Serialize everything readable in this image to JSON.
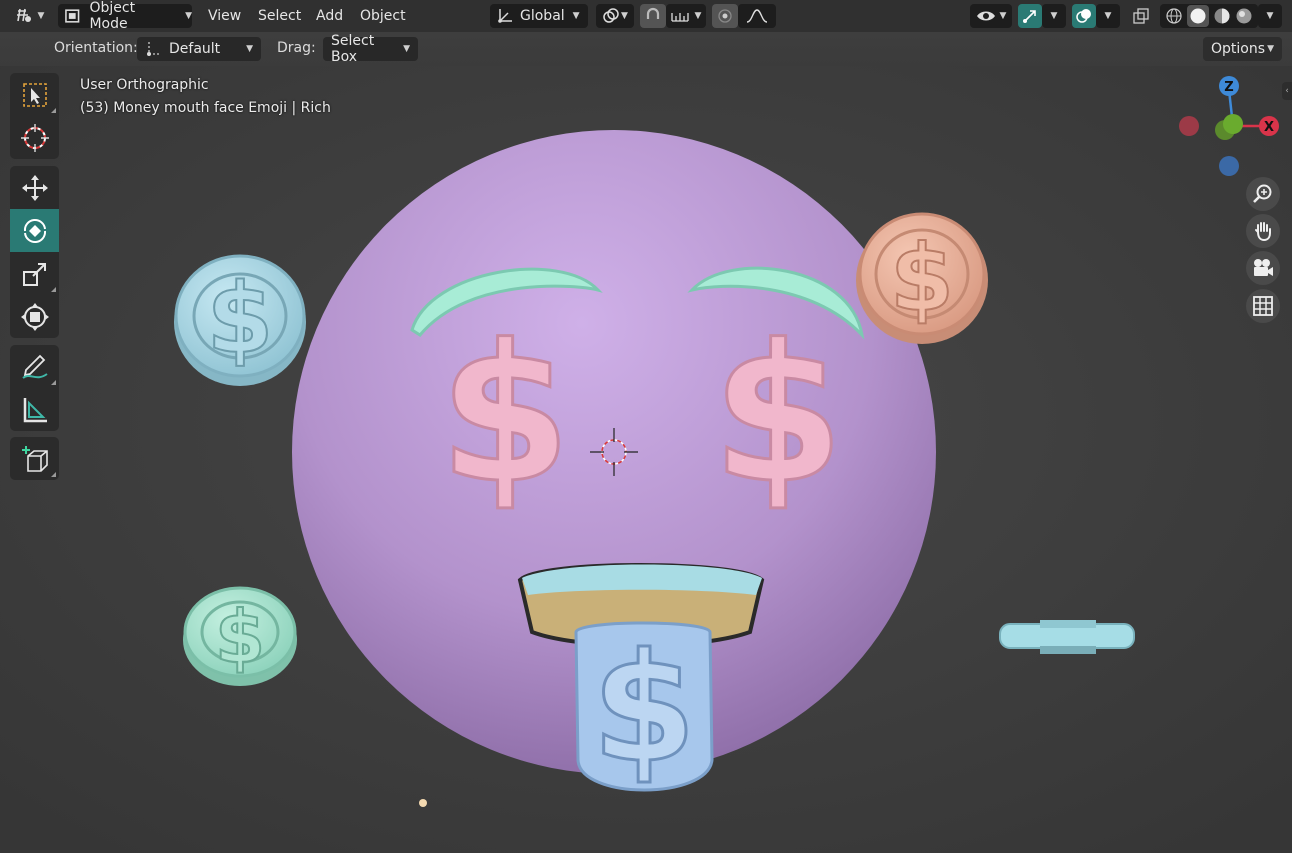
{
  "header": {
    "mode_label": "Object Mode",
    "menus": [
      "View",
      "Select",
      "Add",
      "Object"
    ],
    "transform_orientation": "Global"
  },
  "tool_settings": {
    "orientation_label": "Orientation:",
    "orientation_value": "Default",
    "drag_label": "Drag:",
    "drag_value": "Select Box",
    "options_label": "Options"
  },
  "viewport": {
    "view_name": "User Orthographic",
    "object_info": "(53) Money mouth face Emoji | Rich",
    "gizmo": {
      "z": "Z",
      "x": "X"
    }
  },
  "colors": {
    "accent": "#2a7a74",
    "header_bg": "#303030",
    "viewport_bg": "#3d3d3d",
    "axis_x": "#d9344a",
    "axis_y": "#6aab2e",
    "axis_z": "#3e8ad8"
  },
  "icons": [
    "editor-type-icon",
    "object-mode-icon",
    "transform-orientation-icon",
    "pivot-icon",
    "snap-icon",
    "proportional-edit-icon",
    "visibility-icon",
    "gizmo-icon",
    "overlay-icon",
    "xray-icon",
    "wireframe-shading-icon",
    "solid-shading-icon",
    "material-shading-icon",
    "rendered-shading-icon",
    "select-box-icon",
    "cursor-icon",
    "move-icon",
    "rotate-icon",
    "scale-icon",
    "transform-icon",
    "annotate-icon",
    "measure-icon",
    "add-cube-icon",
    "zoom-icon",
    "hand-icon",
    "camera-icon",
    "grid-icon"
  ]
}
